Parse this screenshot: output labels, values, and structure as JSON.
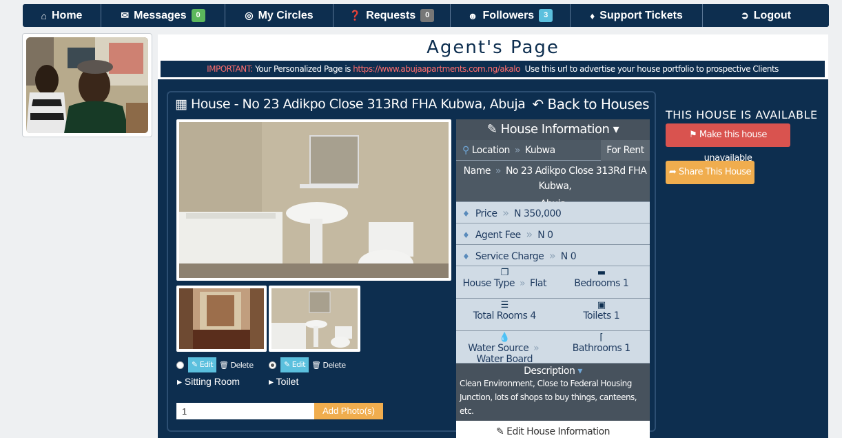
{
  "nav": {
    "home": {
      "label": "Home",
      "icon": "home-icon"
    },
    "messages": {
      "label": "Messages",
      "badge": "0",
      "icon": "envelope-icon"
    },
    "circles": {
      "label": "My Circles",
      "icon": "circles-icon"
    },
    "requests": {
      "label": "Requests",
      "badge": "0",
      "icon": "question-icon"
    },
    "followers": {
      "label": "Followers",
      "badge": "3",
      "icon": "user-icon"
    },
    "tickets": {
      "label": "Support Tickets",
      "icon": "tag-icon"
    },
    "logout": {
      "label": "Logout",
      "icon": "logout-icon"
    }
  },
  "header": {
    "title": "Agent's Page",
    "important_label": "IMPORTANT:",
    "url_prefix": "Your Personalized Page is",
    "url": "https://www.abujaapartments.com.ng/akalo",
    "url_suffix": "Use this url to advertise your house portfolio to prospective Clients"
  },
  "house": {
    "title": "House - No 23 Adikpo Close 313Rd FHA Kubwa, Abuja",
    "back_label": "Back to Houses"
  },
  "photos": {
    "thumbs": [
      {
        "caption": "Sitting Room",
        "edit_label": "Edit",
        "delete_label": "Delete",
        "selected": false
      },
      {
        "caption": "Toilet",
        "edit_label": "Edit",
        "delete_label": "Delete",
        "selected": true
      }
    ],
    "upload_value": "1",
    "upload_button": "Add Photo(s)"
  },
  "info": {
    "heading": "House Information",
    "location_label": "Location",
    "location_value": "Kubwa",
    "status": "For Rent",
    "name_label": "Name",
    "name_value": "No 23 Adikpo Close 313Rd FHA Kubwa,",
    "name_value2": "Abuja",
    "price_label": "Price",
    "price_value": "N 350,000",
    "agent_fee_label": "Agent Fee",
    "agent_fee_value": "N 0",
    "service_label": "Service Charge",
    "service_value": "N 0",
    "house_type_label": "House Type",
    "house_type_value": "Flat",
    "bedrooms_label": "Bedrooms",
    "bedrooms_value": "1",
    "total_rooms_label": "Total Rooms",
    "total_rooms_value": "4",
    "toilets_label": "Toilets",
    "toilets_value": "1",
    "water_label": "Water Source",
    "water_value": "Water Board",
    "bathrooms_label": "Bathrooms",
    "bathrooms_value": "1",
    "description_label": "Description",
    "description": "Clean Environment, Close to Federal Housing Junction, lots of shops to buy things, canteens, etc.",
    "edit_label": "Edit House Information"
  },
  "side": {
    "availability": "THIS HOUSE IS AVAILABLE",
    "unavailable_button": "Make this house unavailable",
    "share_button": "Share This House"
  },
  "colors": {
    "navy": "#0d2e4f",
    "danger": "#d9534f",
    "warning": "#f0ad4e",
    "info": "#5bc0de",
    "success": "#5cb85c"
  }
}
